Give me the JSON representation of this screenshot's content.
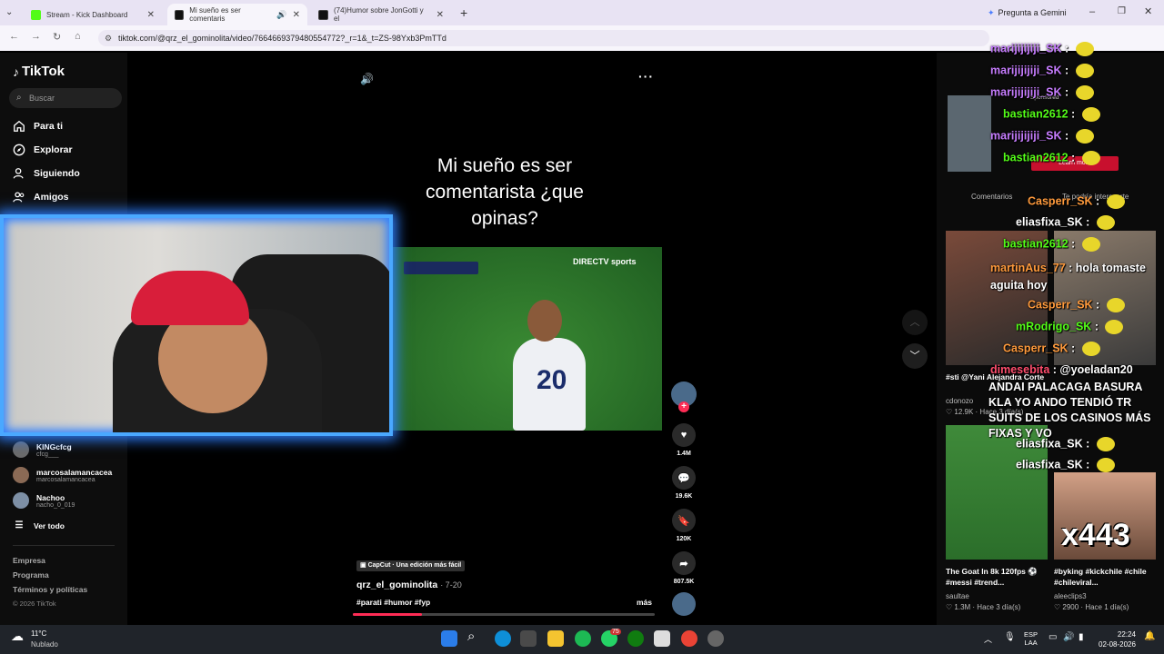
{
  "browser": {
    "tabs": [
      {
        "title": "Stream - Kick Dashboard",
        "color": "#53fc18"
      },
      {
        "title": "Mi sueño es ser comentaris",
        "color": "#111111"
      },
      {
        "title": "(74)Humor sobre JonGotti y el",
        "color": "#111111"
      }
    ],
    "gemini": "Pregunta a Gemini",
    "url": "tiktok.com/@qrz_el_gominolita/video/7664669379480554772?_r=1&_t=ZS-98Yxb3PmTTd"
  },
  "sidebar": {
    "logo": "TikTok",
    "search_placeholder": "Buscar",
    "nav": [
      "Para ti",
      "Explorar",
      "Siguiendo",
      "Amigos"
    ],
    "following": [
      {
        "name": "KINGcfcg",
        "handle": "cfcg___"
      },
      {
        "name": "marcosalamancacea",
        "handle": "marcosalamancacea"
      },
      {
        "name": "Nachoo",
        "handle": "nacho_0_019"
      }
    ],
    "see_all": "Ver todo",
    "footer": [
      "Empresa",
      "Programa",
      "Términos y políticas",
      "© 2026 TikTok"
    ]
  },
  "video": {
    "caption": "Mi sueño es ser comentarista ¿que opinas?",
    "capcut": "CapCut · Una edición más fácil",
    "author": "qrz_el_gominolita",
    "date": "· 7-20",
    "tags": "#parati #humor #fyp",
    "more": "más",
    "player_number": "20",
    "broadcast": "DIRECTV sports",
    "progress": 0.23
  },
  "actions": {
    "likes": "1.4M",
    "comments": "19.6K",
    "saves": "120K",
    "shares": "807.5K"
  },
  "chat": [
    {
      "user": "marijijijiji_SK",
      "msg": "",
      "color": "#c77dff"
    },
    {
      "user": "marijijijiji_SK",
      "msg": "",
      "color": "#c77dff"
    },
    {
      "user": "marijijijiji_SK",
      "msg": "",
      "color": "#c77dff"
    },
    {
      "user": "bastian2612",
      "msg": "",
      "color": "#53fc18"
    },
    {
      "user": "marijijijiji_SK",
      "msg": "",
      "color": "#c77dff"
    },
    {
      "user": "bastian2612",
      "msg": "",
      "color": "#53fc18"
    },
    {
      "user": "Casperr_SK",
      "msg": "",
      "color": "#ff9a3c"
    },
    {
      "user": "eliasfixa_SK",
      "msg": "",
      "color": "#ffffff"
    },
    {
      "user": "bastian2612",
      "msg": "",
      "color": "#53fc18"
    },
    {
      "user": "martinAus_77",
      "msg": "hola tomaste aguita hoy",
      "color": "#ff9a3c"
    },
    {
      "user": "Casperr_SK",
      "msg": "",
      "color": "#ff9a3c"
    },
    {
      "user": "mRodrigo_SK",
      "msg": "",
      "color": "#53fc18"
    },
    {
      "user": "Casperr_SK",
      "msg": "",
      "color": "#ff9a3c"
    },
    {
      "user": "dimesebita",
      "msg": "@yoeladan20",
      "color": "#ff4d6d"
    },
    {
      "user": "",
      "msg": "ANDAI PALACAGA BASURA KLA YO ANDO TENDIÓ TR SUITS DE LOS CASINOS MÁS FIXAS Y VO",
      "color": "#ffffff"
    },
    {
      "user": "eliasfixa_SK",
      "msg": "",
      "color": "#ffffff"
    },
    {
      "user": "eliasfixa_SK",
      "msg": "",
      "color": "#ffffff"
    }
  ],
  "recommended": [
    {
      "title": "#sti @Yani Alejandra Corte",
      "author": "cdonozo",
      "stats": "12.9K · Hace 3 día(s)"
    },
    {
      "title": "The Goat In 8k 120fps ⚽ #messi #trend...",
      "author": "saultae",
      "stats": "1.3M · Hace 3 día(s)"
    },
    {
      "title": "#byking #kickchile #chile #chileviral...",
      "author": "aleeclips3",
      "stats": "2900 · Hace 1 día(s)"
    }
  ],
  "overlay": {
    "x443": "x443",
    "sponsored": "Sponsored",
    "learn_more": "Learn more",
    "maybe": "Comentarios",
    "interest": "Te podría interesarte"
  },
  "taskbar": {
    "temp": "11°C",
    "weather": "Nublado",
    "lang1": "ESP",
    "lang2": "LAA",
    "time": "22:24",
    "date": "02-08-2026",
    "badge": "75"
  }
}
